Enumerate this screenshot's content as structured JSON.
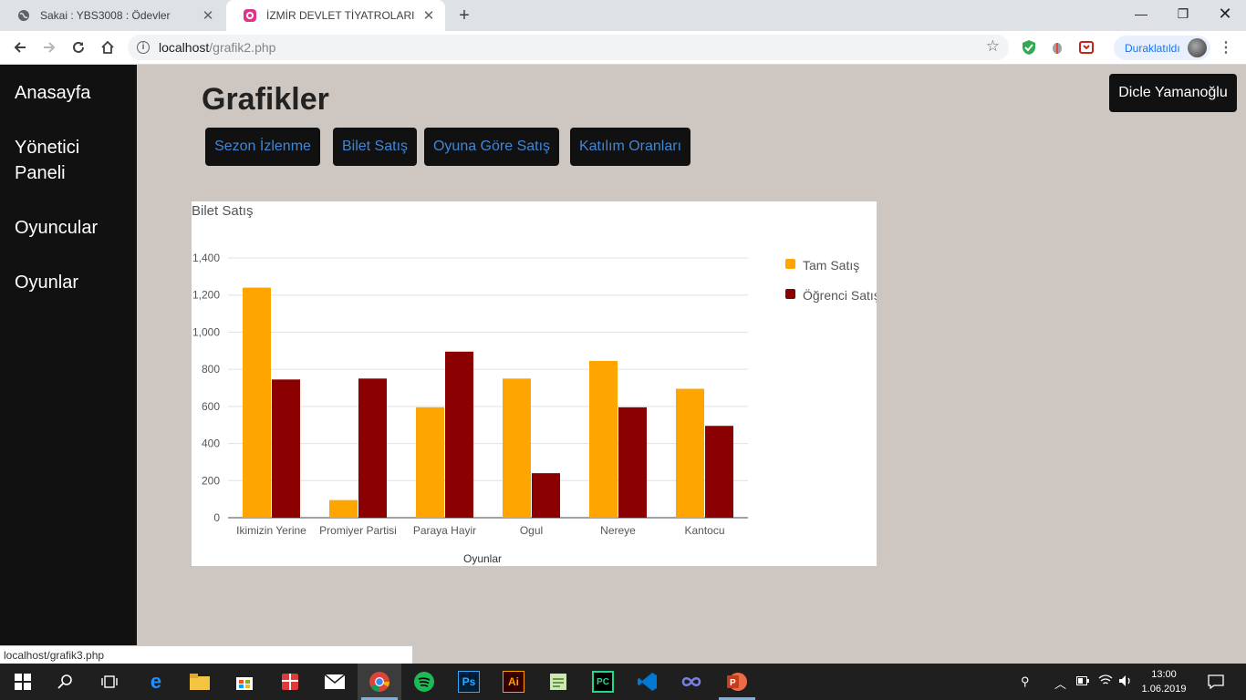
{
  "browser": {
    "tabs": [
      {
        "title": "Sakai : YBS3008 : Ödevler",
        "active": false
      },
      {
        "title": "İZMİR DEVLET TİYATROLARI",
        "active": true
      }
    ],
    "url_host": "localhost",
    "url_path": "/grafik2.php",
    "profile_label": "Duraklatıldı",
    "status_url": "localhost/grafik3.php"
  },
  "sidebar": {
    "items": [
      {
        "label": "Anasayfa"
      },
      {
        "label": "Yönetici"
      },
      {
        "label": "Paneli"
      },
      {
        "label": "Oyuncular"
      },
      {
        "label": "Oyunlar"
      }
    ]
  },
  "page": {
    "title": "Grafikler",
    "user_button": "Dicle Yamanoğlu",
    "buttons": [
      {
        "label": "Sezon İzlenme"
      },
      {
        "label": "Bilet Satış"
      },
      {
        "label": "Oyuna Göre Satış"
      },
      {
        "label": "Katılım Oranları"
      }
    ]
  },
  "chart_data": {
    "type": "bar",
    "title": "Bilet Satış",
    "xlabel": "Oyunlar",
    "ylabel": "",
    "ylim": [
      0,
      1400
    ],
    "yticks": [
      0,
      200,
      400,
      600,
      800,
      1000,
      1200,
      1400
    ],
    "ytick_labels": [
      "0",
      "200",
      "400",
      "600",
      "800",
      "1,000",
      "1,200",
      "1,400"
    ],
    "grid": true,
    "legend_position": "right",
    "categories": [
      "Ikimizin Yerine",
      "Promiyer Partisi",
      "Paraya Hayir",
      "Ogul",
      "Nereye",
      "Kantocu"
    ],
    "series": [
      {
        "name": "Tam Satış",
        "color": "#ffa500",
        "values": [
          1240,
          95,
          595,
          750,
          845,
          695
        ]
      },
      {
        "name": "Öğrenci Satış",
        "color": "#8b0000",
        "values": [
          745,
          750,
          895,
          240,
          595,
          495
        ]
      }
    ]
  },
  "taskbar": {
    "time": "13:00",
    "date": "1.06.2019"
  }
}
